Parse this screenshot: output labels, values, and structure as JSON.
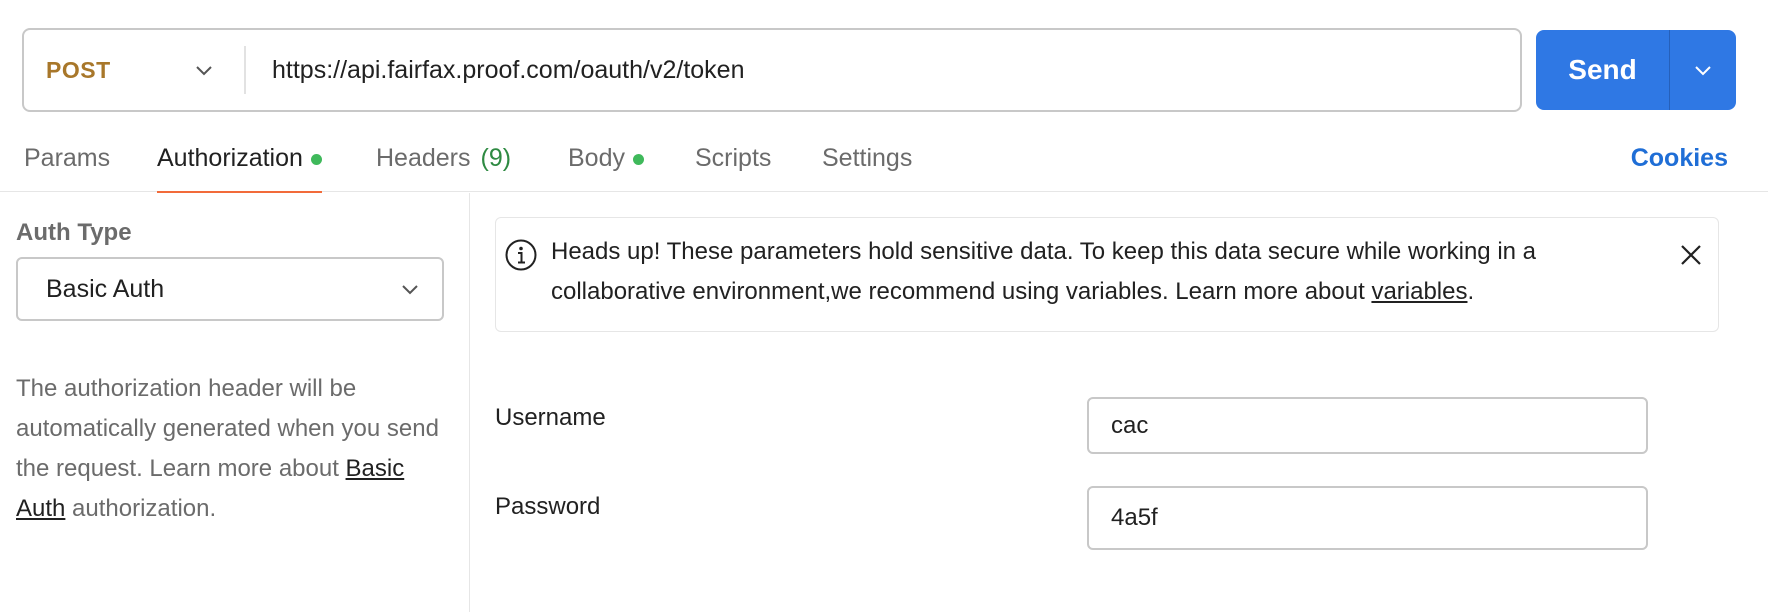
{
  "request": {
    "method": "POST",
    "url": "https://api.fairfax.proof.com/oauth/v2/token",
    "send_label": "Send"
  },
  "tabs": [
    {
      "label": "Params"
    },
    {
      "label": "Authorization",
      "dot": true
    },
    {
      "label": "Headers",
      "count": "(9)"
    },
    {
      "label": "Body",
      "dot": true
    },
    {
      "label": "Scripts"
    },
    {
      "label": "Settings"
    }
  ],
  "active_tab": "Authorization",
  "cookies_label": "Cookies",
  "auth": {
    "type_label": "Auth Type",
    "type_value": "Basic Auth",
    "desc_pre": "The authorization header will be automatically generated when you send the request. Learn more about ",
    "desc_link": "Basic Auth",
    "desc_post": " authorization."
  },
  "alert": {
    "text": "Heads up! These parameters hold sensitive data. To keep this data secure while working in a collaborative environment,we recommend using variables. Learn more about ",
    "link": "variables",
    "end": "."
  },
  "fields": {
    "username_label": "Username",
    "username_value": "cac",
    "password_label": "Password",
    "password_value": "4a5f"
  },
  "colors": {
    "method": "#a8772a",
    "send": "#2f78e4",
    "active_tab_underline": "#f26b3a",
    "dot": "#3fb95b",
    "cookies": "#1f6ed6"
  },
  "icons": [
    "chevron-down-icon",
    "info-icon",
    "close-icon"
  ]
}
